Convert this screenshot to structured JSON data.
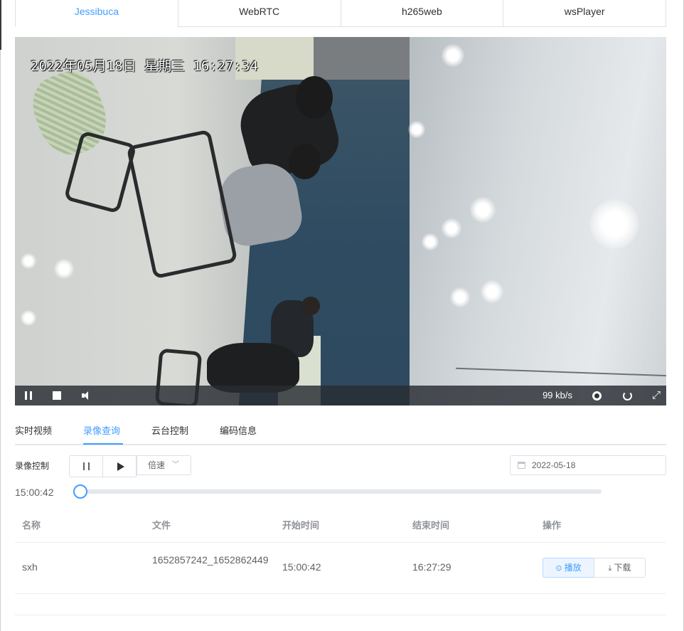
{
  "player_tabs": [
    {
      "label": "Jessibuca",
      "active": true
    },
    {
      "label": "WebRTC",
      "active": false
    },
    {
      "label": "h265web",
      "active": false
    },
    {
      "label": "wsPlayer",
      "active": false
    }
  ],
  "video": {
    "osd_text": "2022年05月18日  星期三  16:27:34",
    "bitrate": "99 kb/s",
    "controls": [
      "pause-icon",
      "stop-icon",
      "volume-icon",
      "screenshot-icon",
      "reload-icon",
      "fullscreen-icon"
    ]
  },
  "info_tabs": [
    {
      "label": "实时视频",
      "active": false
    },
    {
      "label": "录像查询",
      "active": true
    },
    {
      "label": "云台控制",
      "active": false
    },
    {
      "label": "编码信息",
      "active": false
    }
  ],
  "record_control": {
    "label": "录像控制",
    "speed_label": "倍速",
    "date_value": "2022-05-18",
    "current_time": "15:00:42",
    "progress": 0
  },
  "table": {
    "headers": [
      "名称",
      "文件",
      "开始时间",
      "结束时间",
      "操作"
    ],
    "rows": [
      {
        "name": "sxh",
        "file": "1652857242_1652862449",
        "start": "15:00:42",
        "end": "16:27:29",
        "play_label": "播放",
        "download_label": "下载"
      }
    ]
  },
  "colors": {
    "accent": "#409eff",
    "text": "#606266",
    "border": "#dcdfe6"
  }
}
